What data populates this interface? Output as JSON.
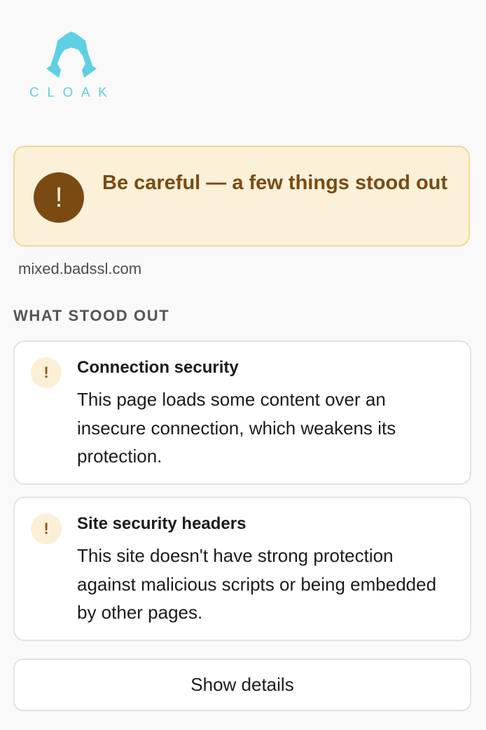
{
  "brand": {
    "logo_text": "CLOAK",
    "logo_icon": "hooded-figure-icon",
    "logo_color": "#5fcfe4"
  },
  "banner": {
    "icon": "exclamation-icon",
    "title": "Be careful — a few things stood out",
    "background_color": "#fbf1d8",
    "accent_color": "#7b4a12"
  },
  "site": {
    "domain": "mixed.badssl.com"
  },
  "findings": {
    "heading": "WHAT STOOD OUT",
    "items": [
      {
        "icon": "exclamation-icon",
        "title": "Connection security",
        "description": "This page loads some content over an insecure connection, which weakens its protection."
      },
      {
        "icon": "exclamation-icon",
        "title": "Site security headers",
        "description": "This site doesn't have strong protection against malicious scripts or being embedded by other pages."
      }
    ]
  },
  "actions": {
    "show_details_label": "Show details"
  }
}
